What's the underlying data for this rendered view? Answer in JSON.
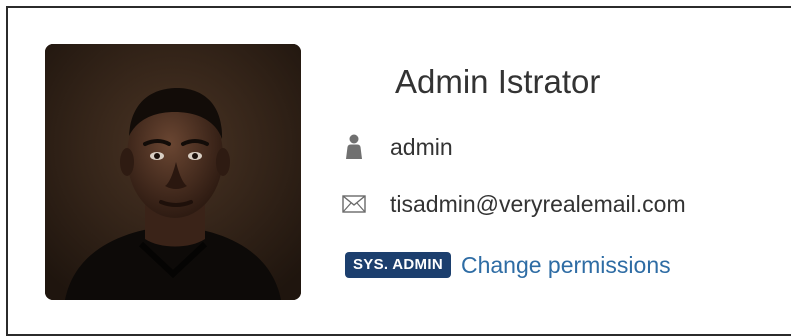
{
  "profile": {
    "name": "Admin Istrator",
    "username": "admin",
    "email": "tisadmin@veryrealemail.com",
    "role_badge": "SYS. ADMIN",
    "change_permissions_label": "Change permissions"
  },
  "icons": {
    "username": "user-icon",
    "email": "envelope-icon"
  },
  "colors": {
    "badge_background": "#1c3f6e",
    "link": "#2e6ca4",
    "text": "#333333",
    "border": "#2b2b2b"
  }
}
